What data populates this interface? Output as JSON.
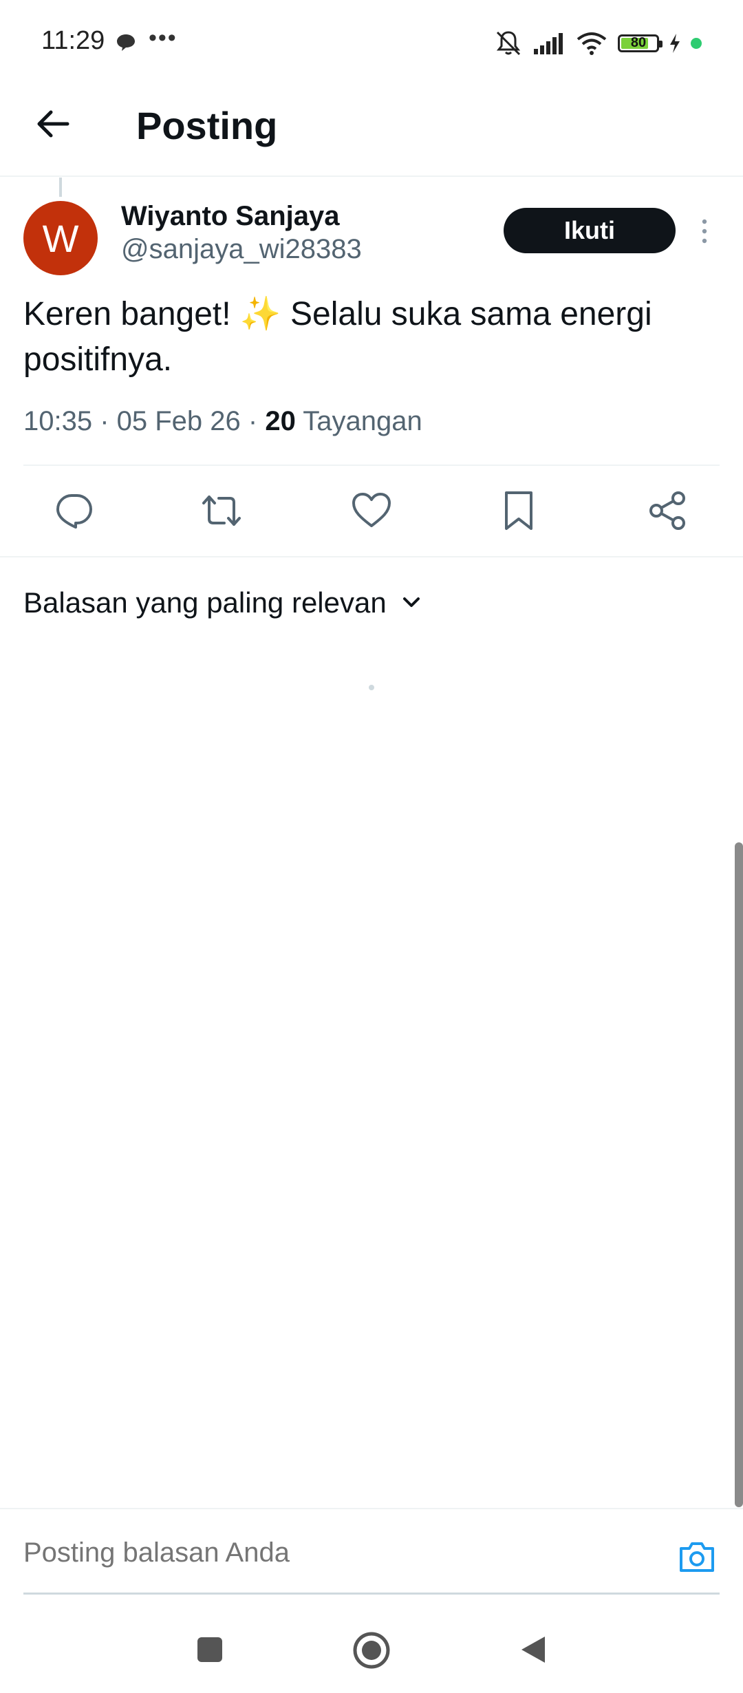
{
  "status_bar": {
    "time": "11:29",
    "more": "•••",
    "battery": "80",
    "battery_level": 0.8,
    "icons": [
      "chat-bubble-icon",
      "mute-icon",
      "signal-icon",
      "wifi-icon",
      "battery-icon",
      "charging-icon"
    ]
  },
  "header": {
    "title": "Posting",
    "back_icon": "arrow-left-icon"
  },
  "post": {
    "avatar_letter": "W",
    "avatar_color": "#c2310b",
    "author_name": "Wiyanto Sanjaya",
    "author_handle": "@sanjaya_wi28383",
    "follow_label": "Ikuti",
    "text": "Keren banget! ✨ Selalu suka sama energi positifnya.",
    "time": "10:35 · 05 Feb 26 · ",
    "views_count": "20",
    "views_label": " Tayangan"
  },
  "actions": [
    "reply-icon",
    "retweet-icon",
    "like-icon",
    "bookmark-icon",
    "share-icon"
  ],
  "sort": {
    "label": "Balasan yang paling relevan"
  },
  "reply": {
    "placeholder": "Posting balasan Anda"
  },
  "colors": {
    "text_primary": "#0f1419",
    "text_secondary": "#536471",
    "accent": "#1d9bf0",
    "divider": "#eff3f4"
  }
}
